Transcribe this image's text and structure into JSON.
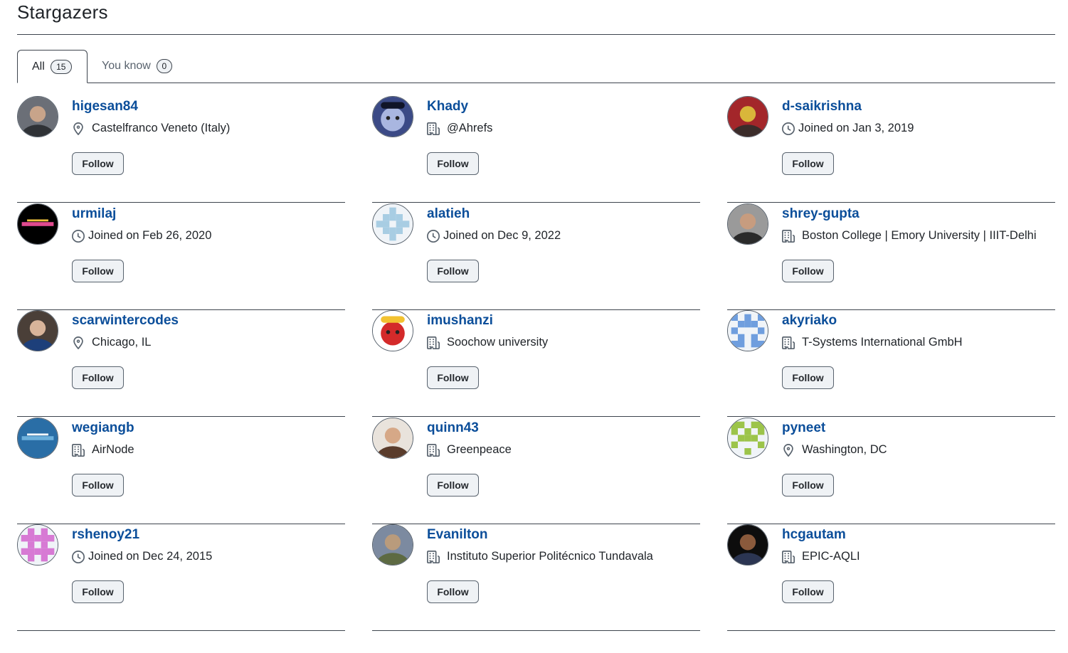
{
  "page_title": "Stargazers",
  "tabs": [
    {
      "label": "All",
      "count": "15"
    },
    {
      "label": "You know",
      "count": "0"
    }
  ],
  "users": [
    {
      "username": "higesan84",
      "meta_icon": "location-icon",
      "meta_text": "Castelfranco Veneto (Italy)",
      "follow_label": "Follow",
      "avatar": "photo",
      "avatar_colors": [
        "#6b6f77",
        "#2f3236",
        "#c8a48a"
      ]
    },
    {
      "username": "Khady",
      "meta_icon": "organization-icon",
      "meta_text": "@Ahrefs",
      "follow_label": "Follow",
      "avatar": "cartoon",
      "avatar_colors": [
        "#3b4a86",
        "#a9b6e0",
        "#101428"
      ]
    },
    {
      "username": "d-saikrishna",
      "meta_icon": "clock-icon",
      "meta_text": "Joined on Jan 3, 2019",
      "follow_label": "Follow",
      "avatar": "photo",
      "avatar_colors": [
        "#a3262a",
        "#3b2c2a",
        "#d9b63a"
      ]
    },
    {
      "username": "urmilaj",
      "meta_icon": "clock-icon",
      "meta_text": "Joined on Feb 26, 2020",
      "follow_label": "Follow",
      "avatar": "logo",
      "avatar_colors": [
        "#000000",
        "#e04a8f",
        "#f0c23b"
      ]
    },
    {
      "username": "alatieh",
      "meta_icon": "clock-icon",
      "meta_text": "Joined on Dec 9, 2022",
      "follow_label": "Follow",
      "avatar": "identicon",
      "avatar_colors": [
        "#f0f4f8",
        "#a8cde3"
      ]
    },
    {
      "username": "shrey-gupta",
      "meta_icon": "organization-icon",
      "meta_text": "Boston College | Emory University | IIIT-Delhi",
      "follow_label": "Follow",
      "avatar": "photo",
      "avatar_colors": [
        "#9a9a9a",
        "#2a2a2a",
        "#c79c7f"
      ]
    },
    {
      "username": "scarwintercodes",
      "meta_icon": "location-icon",
      "meta_text": "Chicago, IL",
      "follow_label": "Follow",
      "avatar": "photo",
      "avatar_colors": [
        "#4a3f38",
        "#1d3f7a",
        "#d8b49a"
      ]
    },
    {
      "username": "imushanzi",
      "meta_icon": "organization-icon",
      "meta_text": "Soochow university",
      "follow_label": "Follow",
      "avatar": "cartoon",
      "avatar_colors": [
        "#ffffff",
        "#d42a2a",
        "#f2c230"
      ]
    },
    {
      "username": "akyriako",
      "meta_icon": "organization-icon",
      "meta_text": "T-Systems International GmbH",
      "follow_label": "Follow",
      "avatar": "identicon",
      "avatar_colors": [
        "#f0f4f8",
        "#6f9ede"
      ]
    },
    {
      "username": "wegiangb",
      "meta_icon": "organization-icon",
      "meta_text": "AirNode",
      "follow_label": "Follow",
      "avatar": "logo",
      "avatar_colors": [
        "#2a6ea6",
        "#6cb0dc",
        "#ffffff"
      ]
    },
    {
      "username": "quinn43",
      "meta_icon": "organization-icon",
      "meta_text": "Greenpeace",
      "follow_label": "Follow",
      "avatar": "photo",
      "avatar_colors": [
        "#e9e3dc",
        "#5a3c2c",
        "#d6a887"
      ]
    },
    {
      "username": "pyneet",
      "meta_icon": "location-icon",
      "meta_text": "Washington, DC",
      "follow_label": "Follow",
      "avatar": "identicon",
      "avatar_colors": [
        "#f0f4f8",
        "#9cc44a"
      ]
    },
    {
      "username": "rshenoy21",
      "meta_icon": "clock-icon",
      "meta_text": "Joined on Dec 24, 2015",
      "follow_label": "Follow",
      "avatar": "identicon",
      "avatar_colors": [
        "#f0f4f8",
        "#d77ad4"
      ]
    },
    {
      "username": "Evanilton",
      "meta_icon": "organization-icon",
      "meta_text": "Instituto Superior Politécnico Tundavala",
      "follow_label": "Follow",
      "avatar": "photo",
      "avatar_colors": [
        "#7c8aa0",
        "#5d6a42",
        "#b99b7c"
      ]
    },
    {
      "username": "hcgautam",
      "meta_icon": "organization-icon",
      "meta_text": "EPIC-AQLI",
      "follow_label": "Follow",
      "avatar": "photo",
      "avatar_colors": [
        "#0d0d0d",
        "#2b3552",
        "#8a5a3c"
      ]
    }
  ]
}
